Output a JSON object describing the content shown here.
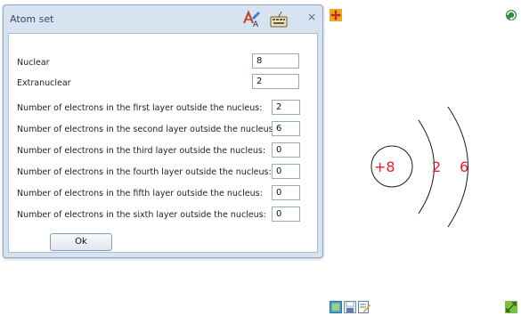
{
  "dialog": {
    "title": "Atom set",
    "close_glyph": "×",
    "title_icons": [
      "text-style-icon",
      "keyboard-icon"
    ],
    "fields": [
      {
        "label": "Nuclear",
        "value": "8"
      },
      {
        "label": "Extranuclear",
        "value": "2"
      },
      {
        "label": "Number of electrons in the first layer outside the nucleus:",
        "value": "2"
      },
      {
        "label": "Number of electrons in the second layer outside the nucleus:",
        "value": "6"
      },
      {
        "label": "Number of electrons in the third layer outside the nucleus:",
        "value": "0"
      },
      {
        "label": "Number of electrons in the fourth layer outside the nucleus:",
        "value": "0"
      },
      {
        "label": "Number of electrons in the fifth layer outside the nucleus:",
        "value": "0"
      },
      {
        "label": "Number of electrons in the sixth layer outside the nucleus:",
        "value": "0"
      }
    ],
    "ok_label": "Ok"
  },
  "diagram": {
    "nucleus_label": "+8",
    "shell_values": [
      "2",
      "6"
    ],
    "color": "#e8202a"
  },
  "toolbar_icons": [
    "move-icon",
    "rotate-icon",
    "image-icon",
    "save-icon",
    "edit-icon",
    "resize-icon"
  ]
}
